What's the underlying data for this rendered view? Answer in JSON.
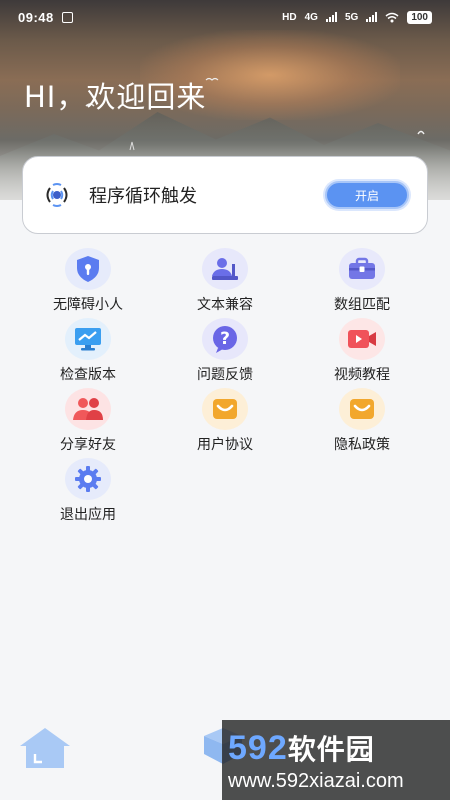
{
  "status_bar": {
    "time": "09:48",
    "network_hd": "HD",
    "network_4g": "4G",
    "network_5g": "5G",
    "battery": "100"
  },
  "greeting": "HI，欢迎回来",
  "trigger_card": {
    "title": "程序循环触发",
    "button_label": "开启"
  },
  "menu": [
    {
      "label": "无障碍小人",
      "icon": "shield-keyhole-icon",
      "color": "#5b7cf0"
    },
    {
      "label": "文本兼容",
      "icon": "user-desk-icon",
      "color": "#6a6ee8"
    },
    {
      "label": "数组匹配",
      "icon": "toolbox-icon",
      "color": "#7376e6"
    },
    {
      "label": "检查版本",
      "icon": "trend-monitor-icon",
      "color": "#3a9ef0"
    },
    {
      "label": "问题反馈",
      "icon": "question-bubble-icon",
      "color": "#6a66e6"
    },
    {
      "label": "视频教程",
      "icon": "video-camera-icon",
      "color": "#f0525a"
    },
    {
      "label": "分享好友",
      "icon": "people-icon",
      "color": "#f0585a"
    },
    {
      "label": "用户协议",
      "icon": "smile-box-icon",
      "color": "#f2a72c"
    },
    {
      "label": "隐私政策",
      "icon": "smile-box-icon",
      "color": "#f2a72c"
    },
    {
      "label": "退出应用",
      "icon": "gear-icon",
      "color": "#5b7cf0"
    }
  ],
  "watermark": {
    "number": "592",
    "name": "软件园",
    "url": "www.592xiazai.com"
  },
  "colors": {
    "accent": "#5b93f2",
    "page_bg": "#f5f6f8"
  }
}
